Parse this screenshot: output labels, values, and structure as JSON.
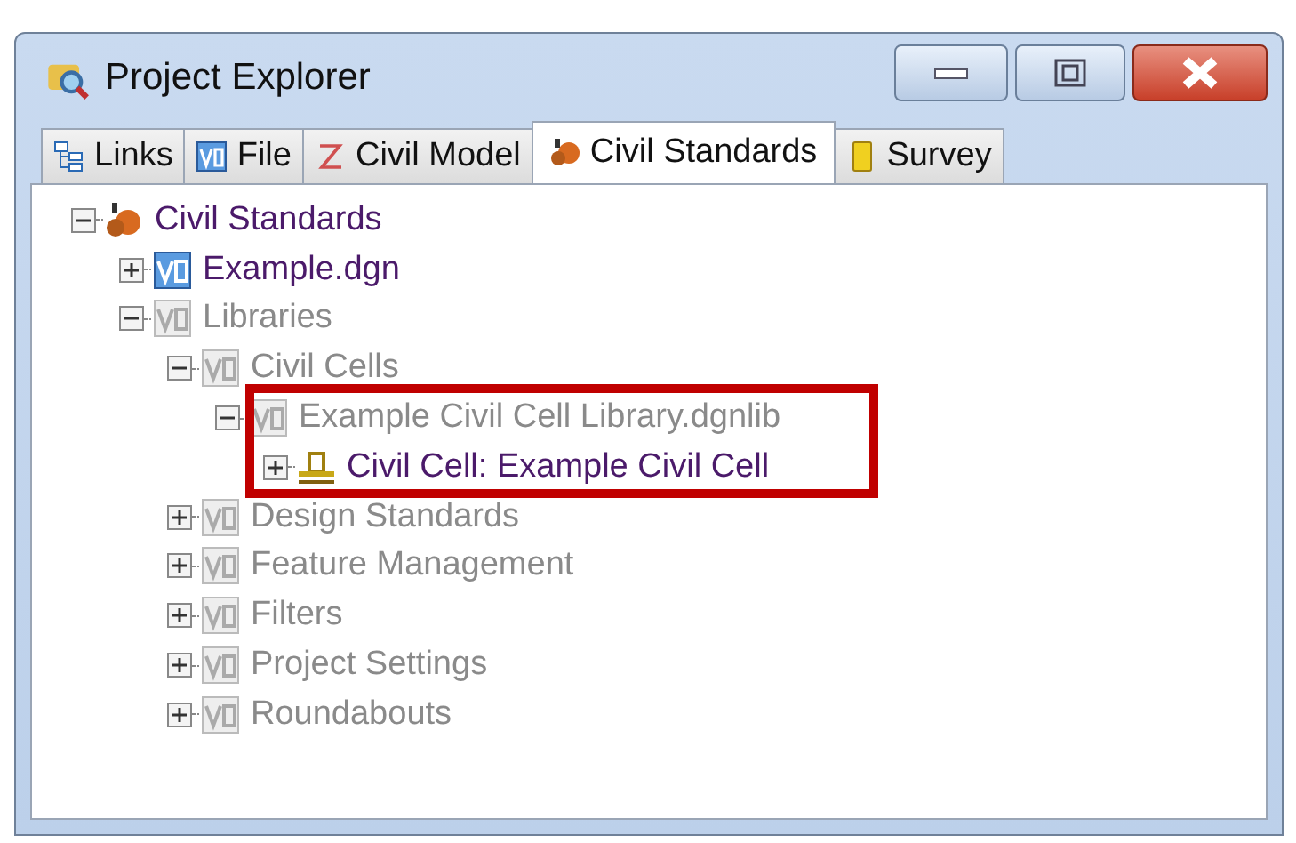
{
  "window": {
    "title": "Project Explorer"
  },
  "tabs": [
    {
      "label": "Links",
      "kind": "links",
      "selected": false
    },
    {
      "label": "File",
      "kind": "v8",
      "selected": false
    },
    {
      "label": "Civil Model",
      "kind": "model",
      "selected": false
    },
    {
      "label": "Civil Standards",
      "kind": "standards",
      "selected": true
    },
    {
      "label": "Survey",
      "kind": "survey",
      "selected": false
    }
  ],
  "tree": [
    {
      "label": "Civil Standards",
      "kind": "standards",
      "expanded": true,
      "dimmed": false,
      "highlighted": false,
      "children": [
        {
          "label": "Example.dgn",
          "kind": "v8",
          "expanded": false,
          "dimmed": false,
          "highlighted": false
        },
        {
          "label": "Libraries",
          "kind": "v8",
          "expanded": true,
          "dimmed": true,
          "highlighted": false,
          "children": [
            {
              "label": "Civil Cells",
              "kind": "v8",
              "expanded": true,
              "dimmed": true,
              "highlighted": false,
              "children": [
                {
                  "label": "Example Civil Cell Library.dgnlib",
                  "kind": "v8",
                  "expanded": true,
                  "dimmed": true,
                  "highlighted": true,
                  "children": [
                    {
                      "label": "Civil Cell: Example Civil Cell",
                      "kind": "cell",
                      "expanded": false,
                      "dimmed": false,
                      "highlighted": false
                    }
                  ]
                }
              ]
            },
            {
              "label": "Design Standards",
              "kind": "v8",
              "expanded": false,
              "dimmed": true,
              "highlighted": false
            },
            {
              "label": "Feature Management",
              "kind": "v8",
              "expanded": false,
              "dimmed": true,
              "highlighted": false
            },
            {
              "label": "Filters",
              "kind": "v8",
              "expanded": false,
              "dimmed": true,
              "highlighted": false
            },
            {
              "label": "Project Settings",
              "kind": "v8",
              "expanded": false,
              "dimmed": true,
              "highlighted": false
            },
            {
              "label": "Roundabouts",
              "kind": "v8",
              "expanded": false,
              "dimmed": true,
              "highlighted": false
            }
          ]
        }
      ]
    }
  ]
}
